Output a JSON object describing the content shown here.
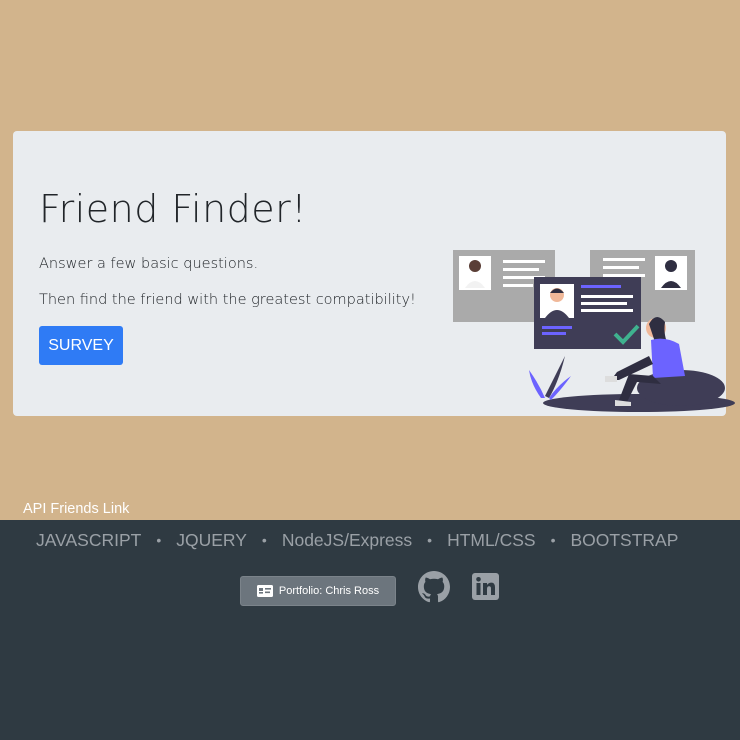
{
  "hero": {
    "title": "Friend Finder!",
    "lead_1": "Answer a few basic questions.",
    "lead_2": "Then find the friend with the greatest compatibility!",
    "survey_button": "SURVEY"
  },
  "api_link": "API Friends Link",
  "footer": {
    "tech": [
      "JAVASCRIPT",
      "JQUERY",
      "NodeJS/Express",
      "HTML/CSS",
      "BOOTSTRAP"
    ],
    "separator": "•",
    "portfolio_button": "Portfolio: Chris Ross"
  },
  "colors": {
    "page_background": "#d2b48c",
    "jumbotron": "#e9ecef",
    "primary_button": "#2f7bf5",
    "footer": "#2f3a42",
    "accent_purple": "#6c63ff"
  },
  "icons": [
    "profile-cards-illustration",
    "id-card-icon",
    "github-icon",
    "linkedin-icon"
  ]
}
